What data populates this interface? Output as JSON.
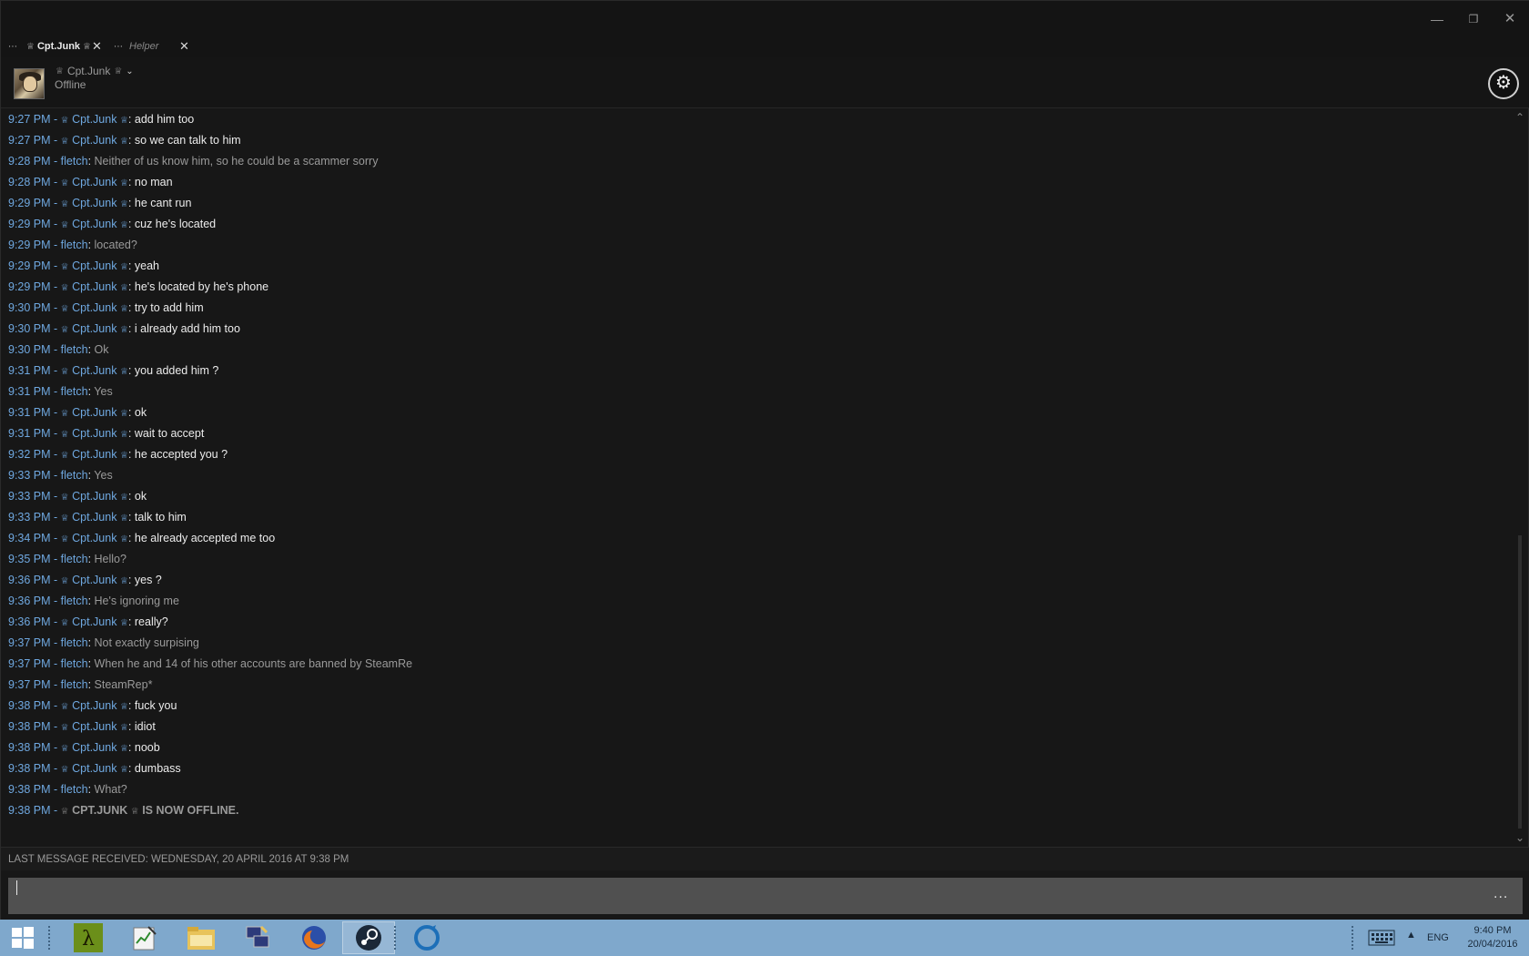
{
  "window": {
    "minimize_icon": "minimize-icon",
    "restore_icon": "restore-icon",
    "close_icon": "close-icon"
  },
  "tabs": [
    {
      "label": "Cpt.Junk",
      "active": true
    },
    {
      "label": "Helper",
      "active": false
    }
  ],
  "header": {
    "name": "Cpt.Junk",
    "status": "Offline"
  },
  "self_name": "Cpt.Junk",
  "other_name": "fletch",
  "messages": [
    {
      "time": "9:27 PM",
      "from": "me",
      "text": "add him too"
    },
    {
      "time": "9:27 PM",
      "from": "me",
      "text": "so we can talk to him"
    },
    {
      "time": "9:28 PM",
      "from": "other",
      "text": "Neither of us know him, so he could be a scammer sorry"
    },
    {
      "time": "9:28 PM",
      "from": "me",
      "text": "no man"
    },
    {
      "time": "9:29 PM",
      "from": "me",
      "text": "he cant  run"
    },
    {
      "time": "9:29 PM",
      "from": "me",
      "text": "cuz he's located"
    },
    {
      "time": "9:29 PM",
      "from": "other",
      "text": "located?"
    },
    {
      "time": "9:29 PM",
      "from": "me",
      "text": "yeah"
    },
    {
      "time": "9:29 PM",
      "from": "me",
      "text": "he's located by he's phone"
    },
    {
      "time": "9:30 PM",
      "from": "me",
      "text": "try to add him"
    },
    {
      "time": "9:30 PM",
      "from": "me",
      "text": "i already add him too"
    },
    {
      "time": "9:30 PM",
      "from": "other",
      "text": "Ok"
    },
    {
      "time": "9:31 PM",
      "from": "me",
      "text": "you added him ?"
    },
    {
      "time": "9:31 PM",
      "from": "other",
      "text": "Yes"
    },
    {
      "time": "9:31 PM",
      "from": "me",
      "text": "ok"
    },
    {
      "time": "9:31 PM",
      "from": "me",
      "text": "wait to accept"
    },
    {
      "time": "9:32 PM",
      "from": "me",
      "text": "he accepted you ?"
    },
    {
      "time": "9:33 PM",
      "from": "other",
      "text": "Yes"
    },
    {
      "time": "9:33 PM",
      "from": "me",
      "text": "ok"
    },
    {
      "time": "9:33 PM",
      "from": "me",
      "text": "talk to him"
    },
    {
      "time": "9:34 PM",
      "from": "me",
      "text": "he already accepted me too"
    },
    {
      "time": "9:35 PM",
      "from": "other",
      "text": "Hello?"
    },
    {
      "time": "9:36 PM",
      "from": "me",
      "text": "yes ?"
    },
    {
      "time": "9:36 PM",
      "from": "other",
      "text": "He's ignoring me"
    },
    {
      "time": "9:36 PM",
      "from": "me",
      "text": "really?"
    },
    {
      "time": "9:37 PM",
      "from": "other",
      "text": "Not exactly surpising"
    },
    {
      "time": "9:37 PM",
      "from": "other",
      "text": "When he and 14 of his other accounts are banned by SteamRe"
    },
    {
      "time": "9:37 PM",
      "from": "other",
      "text": "SteamRep*"
    },
    {
      "time": "9:38 PM",
      "from": "me",
      "text": "fuck you"
    },
    {
      "time": "9:38 PM",
      "from": "me",
      "text": "idiot"
    },
    {
      "time": "9:38 PM",
      "from": "me",
      "text": "noob"
    },
    {
      "time": "9:38 PM",
      "from": "me",
      "text": "dumbass"
    },
    {
      "time": "9:38 PM",
      "from": "other",
      "text": "What?"
    }
  ],
  "offline_notice": {
    "time": "9:38 PM",
    "name": "CPT.JUNK",
    "text": "IS NOW OFFLINE."
  },
  "last_received": "LAST MESSAGE RECEIVED: WEDNESDAY, 20 APRIL 2016 AT 9:38 PM",
  "input": {
    "value": "",
    "more_label": "..."
  },
  "taskbar": {
    "apps": [
      "start-icon",
      "half-life-icon",
      "notepad-icon",
      "file-explorer-icon",
      "network-icon",
      "firefox-icon",
      "steam-icon",
      "origin-icon"
    ],
    "lang": "ENG",
    "time": "9:40 PM",
    "date": "20/04/2016"
  },
  "colors": {
    "accent_blue": "#6fa8e0",
    "taskbar": "#7fa8cc",
    "input_bg": "#505050"
  }
}
